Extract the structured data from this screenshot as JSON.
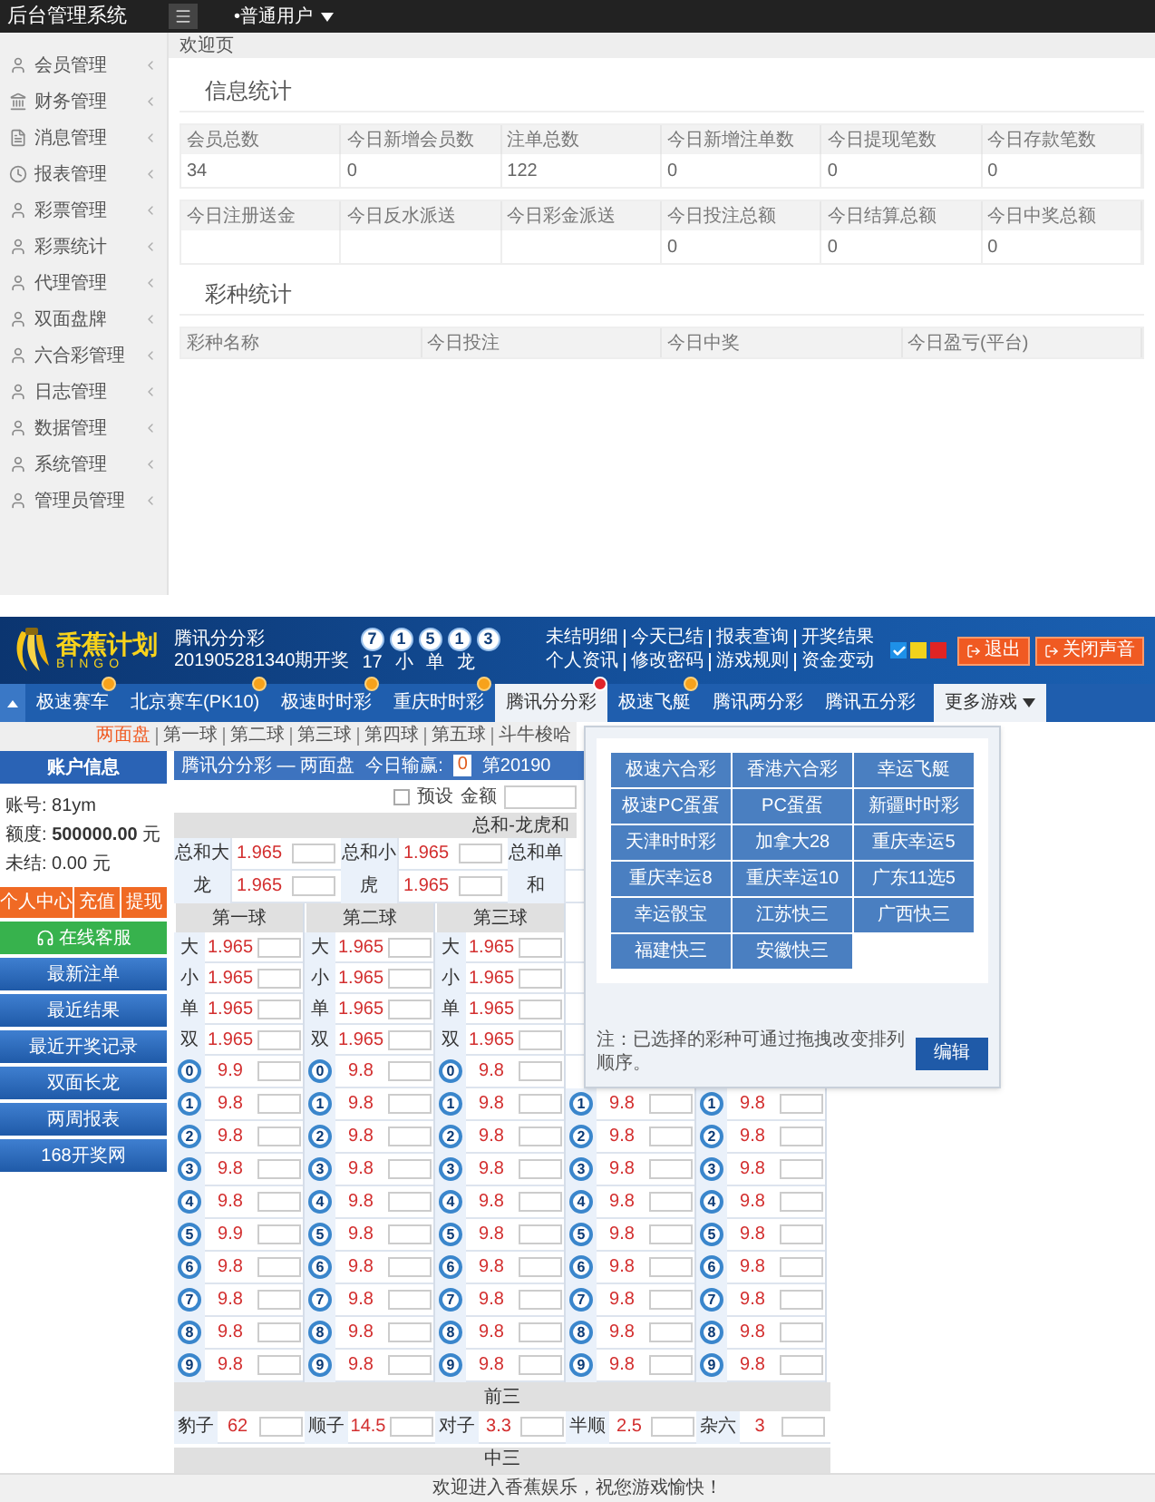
{
  "admin": {
    "title": "后台管理系统",
    "user_menu": "•普通用户",
    "sidebar": {
      "items": [
        {
          "label": "会员管理"
        },
        {
          "label": "财务管理"
        },
        {
          "label": "消息管理"
        },
        {
          "label": "报表管理"
        },
        {
          "label": "彩票管理"
        },
        {
          "label": "彩票统计"
        },
        {
          "label": "代理管理"
        },
        {
          "label": "双面盘牌"
        },
        {
          "label": "六合彩管理"
        },
        {
          "label": "日志管理"
        },
        {
          "label": "数据管理"
        },
        {
          "label": "系统管理"
        },
        {
          "label": "管理员管理"
        }
      ]
    },
    "breadcrumb": "欢迎页",
    "sections": [
      {
        "title": "信息统计",
        "tables": [
          {
            "columns": [
              {
                "label": "会员总数",
                "value": "34"
              },
              {
                "label": "今日新增会员数",
                "value": "0"
              },
              {
                "label": "注单总数",
                "value": "122"
              },
              {
                "label": "今日新增注单数",
                "value": "0"
              },
              {
                "label": "今日提现笔数",
                "value": "0"
              },
              {
                "label": "今日存款笔数",
                "value": "0"
              }
            ]
          },
          {
            "columns": [
              {
                "label": "今日注册送金"
              },
              {
                "label": "今日反水派送"
              },
              {
                "label": "今日彩金派送"
              },
              {
                "label": "今日投注总额",
                "value": "0"
              },
              {
                "label": "今日结算总额",
                "value": "0"
              },
              {
                "label": "今日中奖总额",
                "value": "0"
              }
            ]
          }
        ]
      },
      {
        "title": "彩种统计",
        "tables": [
          {
            "columns": [
              {
                "label": "彩种名称"
              },
              {
                "label": "今日投注"
              },
              {
                "label": "今日中奖"
              },
              {
                "label": "今日盈亏(平台)"
              }
            ]
          }
        ]
      }
    ]
  },
  "lottery": {
    "logo": {
      "name": "香蕉计划",
      "sub": "BINGO"
    },
    "draw": {
      "game": "腾讯分分彩",
      "period": "201905281340期开奖",
      "balls": [
        "7",
        "1",
        "5",
        "1",
        "3"
      ],
      "results": [
        "17",
        "小",
        "单",
        "龙"
      ]
    },
    "links": [
      {
        "items": [
          "未结明细",
          "今天已结",
          "报表查询",
          "开奖结果"
        ]
      },
      {
        "items": [
          "个人资讯",
          "修改密码",
          "游戏规则",
          "资金变动"
        ]
      }
    ],
    "swatches": [
      {
        "color": "#1e90e8",
        "checked": true
      },
      {
        "color": "#f2d21b",
        "checked": false
      },
      {
        "color": "#e02424",
        "checked": false
      }
    ],
    "buttons": [
      {
        "label": "退出"
      },
      {
        "label": "关闭声音"
      }
    ],
    "tabs": [
      {
        "label": "极速赛车",
        "selected": false,
        "hot": true,
        "new": false
      },
      {
        "label": "北京赛车(PK10)",
        "selected": false,
        "hot": true,
        "new": false
      },
      {
        "label": "极速时时彩",
        "selected": false,
        "hot": true,
        "new": false
      },
      {
        "label": "重庆时时彩",
        "selected": false,
        "hot": true,
        "new": false
      },
      {
        "label": "腾讯分分彩",
        "selected": true,
        "hot": false,
        "new": true
      },
      {
        "label": "极速飞艇",
        "selected": false,
        "hot": true,
        "new": false
      },
      {
        "label": "腾讯两分彩",
        "selected": false,
        "hot": false,
        "new": false
      },
      {
        "label": "腾讯五分彩",
        "selected": false,
        "hot": false,
        "new": false
      }
    ],
    "more_tab": {
      "label": "更多游戏",
      "expanded": true
    },
    "subtabs": [
      {
        "label": "两面盘",
        "selected": true
      },
      {
        "label": "第一球",
        "selected": false
      },
      {
        "label": "第二球",
        "selected": false
      },
      {
        "label": "第三球",
        "selected": false
      },
      {
        "label": "第四球",
        "selected": false
      },
      {
        "label": "第五球",
        "selected": false
      },
      {
        "label": "斗牛梭哈",
        "selected": false
      }
    ],
    "account": {
      "title": "账户信息",
      "lines": [
        "账号: 81ym",
        "额度: **500000.00** 元",
        "未结: 0.00 元"
      ],
      "actions": [
        "个人中心",
        "充值",
        "提现"
      ],
      "service": "在线客服",
      "menu": [
        "最新注单",
        "最近结果",
        "最近开奖记录",
        "双面长龙",
        "两周报表",
        "168开奖网"
      ]
    },
    "board": {
      "title": "腾讯分分彩 — 两面盘",
      "today_label": "今日输赢:",
      "today_value": "0",
      "period": "第20190",
      "preset": {
        "label": "预设",
        "checked": false
      },
      "amount_label": "金额",
      "sum": {
        "title": "总和-龙虎和",
        "rows": [
          {
            "items": [
              {
                "label": "总和大",
                "odds": "1.965"
              },
              {
                "label": "总和小",
                "odds": "1.965"
              },
              {
                "label": "总和单"
              }
            ]
          },
          {
            "items": [
              {
                "label": "龙",
                "odds": "1.965"
              },
              {
                "label": "虎",
                "odds": "1.965"
              },
              {
                "label": "和"
              }
            ]
          }
        ]
      },
      "columns": [
        {
          "title": "第一球",
          "sides": [
            {
              "label": "大",
              "odds": "1.965"
            },
            {
              "label": "小",
              "odds": "1.965"
            },
            {
              "label": "单",
              "odds": "1.965"
            },
            {
              "label": "双",
              "odds": "1.965"
            }
          ],
          "numbers": [
            {
              "ball": "0",
              "odds": "9.9"
            },
            {
              "ball": "1",
              "odds": "9.8"
            },
            {
              "ball": "2",
              "odds": "9.8"
            },
            {
              "ball": "3",
              "odds": "9.8"
            },
            {
              "ball": "4",
              "odds": "9.8"
            },
            {
              "ball": "5",
              "odds": "9.9"
            },
            {
              "ball": "6",
              "odds": "9.8"
            },
            {
              "ball": "7",
              "odds": "9.8"
            },
            {
              "ball": "8",
              "odds": "9.8"
            },
            {
              "ball": "9",
              "odds": "9.8"
            }
          ]
        },
        {
          "title": "第二球",
          "sides": [
            {
              "label": "大",
              "odds": "1.965"
            },
            {
              "label": "小",
              "odds": "1.965"
            },
            {
              "label": "单",
              "odds": "1.965"
            },
            {
              "label": "双",
              "odds": "1.965"
            }
          ],
          "numbers": [
            {
              "ball": "0",
              "odds": "9.8"
            },
            {
              "ball": "1",
              "odds": "9.8"
            },
            {
              "ball": "2",
              "odds": "9.8"
            },
            {
              "ball": "3",
              "odds": "9.8"
            },
            {
              "ball": "4",
              "odds": "9.8"
            },
            {
              "ball": "5",
              "odds": "9.8"
            },
            {
              "ball": "6",
              "odds": "9.8"
            },
            {
              "ball": "7",
              "odds": "9.8"
            },
            {
              "ball": "8",
              "odds": "9.8"
            },
            {
              "ball": "9",
              "odds": "9.8"
            }
          ]
        },
        {
          "title": "第三球",
          "sides": [
            {
              "label": "大",
              "odds": "1.965"
            },
            {
              "label": "小",
              "odds": "1.965"
            },
            {
              "label": "单",
              "odds": "1.965"
            },
            {
              "label": "双",
              "odds": "1.965"
            }
          ],
          "numbers": [
            {
              "ball": "0",
              "odds": "9.8"
            },
            {
              "ball": "1",
              "odds": "9.8"
            },
            {
              "ball": "2",
              "odds": "9.8"
            },
            {
              "ball": "3",
              "odds": "9.8"
            },
            {
              "ball": "4",
              "odds": "9.8"
            },
            {
              "ball": "5",
              "odds": "9.8"
            },
            {
              "ball": "6",
              "odds": "9.8"
            },
            {
              "ball": "7",
              "odds": "9.8"
            },
            {
              "ball": "8",
              "odds": "9.8"
            },
            {
              "ball": "9",
              "odds": "9.8"
            }
          ]
        },
        {
          "numbers": [
            {
              "ball": "1",
              "odds": "9.8"
            },
            {
              "ball": "2",
              "odds": "9.8"
            },
            {
              "ball": "3",
              "odds": "9.8"
            },
            {
              "ball": "4",
              "odds": "9.8"
            },
            {
              "ball": "5",
              "odds": "9.8"
            },
            {
              "ball": "6",
              "odds": "9.8"
            },
            {
              "ball": "7",
              "odds": "9.8"
            },
            {
              "ball": "8",
              "odds": "9.8"
            },
            {
              "ball": "9",
              "odds": "9.8"
            }
          ]
        },
        {
          "numbers": [
            {
              "ball": "1",
              "odds": "9.8"
            },
            {
              "ball": "2",
              "odds": "9.8"
            },
            {
              "ball": "3",
              "odds": "9.8"
            },
            {
              "ball": "4",
              "odds": "9.8"
            },
            {
              "ball": "5",
              "odds": "9.8"
            },
            {
              "ball": "6",
              "odds": "9.8"
            },
            {
              "ball": "7",
              "odds": "9.8"
            },
            {
              "ball": "8",
              "odds": "9.8"
            },
            {
              "ball": "9",
              "odds": "9.8"
            }
          ]
        }
      ],
      "front": {
        "title": "前三",
        "items": [
          {
            "label": "豹子",
            "odds": "62"
          },
          {
            "label": "顺子",
            "odds": "14.5"
          },
          {
            "label": "对子",
            "odds": "3.3"
          },
          {
            "label": "半顺",
            "odds": "2.5"
          },
          {
            "label": "杂六",
            "odds": "3"
          }
        ]
      },
      "middle": {
        "title": "中三"
      }
    },
    "more_menu": {
      "games": [
        "极速六合彩",
        "香港六合彩",
        "幸运飞艇",
        "极速PC蛋蛋",
        "PC蛋蛋",
        "新疆时时彩",
        "天津时时彩",
        "加拿大28",
        "重庆幸运5",
        "重庆幸运8",
        "重庆幸运10",
        "广东11选5",
        "幸运骰宝",
        "江苏快三",
        "广西快三",
        "福建快三",
        "安徽快三"
      ],
      "note": "注：已选择的彩种可通过拖拽改变排列顺序。",
      "button": "编辑"
    },
    "footer": "欢迎进入香蕉娱乐，祝您游戏愉快！"
  }
}
